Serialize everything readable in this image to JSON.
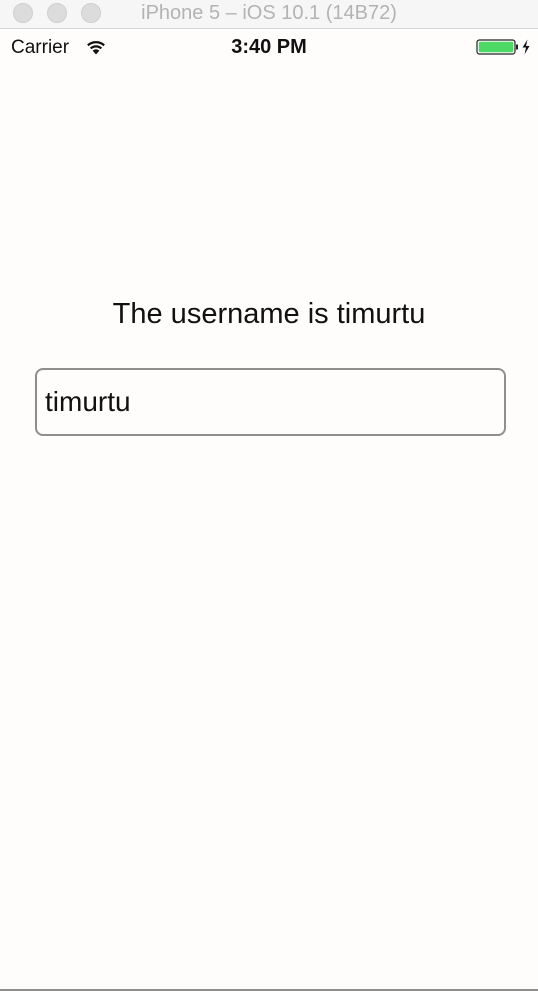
{
  "window": {
    "title": "iPhone 5 – iOS 10.1 (14B72)"
  },
  "statusbar": {
    "carrier": "Carrier",
    "time": "3:40 PM",
    "battery_color": "#4cd964",
    "wifi_icon": "wifi-icon",
    "battery_icon": "battery-charging-icon"
  },
  "main": {
    "label": "The username is timurtu",
    "username_field": {
      "value": "timurtu"
    }
  }
}
